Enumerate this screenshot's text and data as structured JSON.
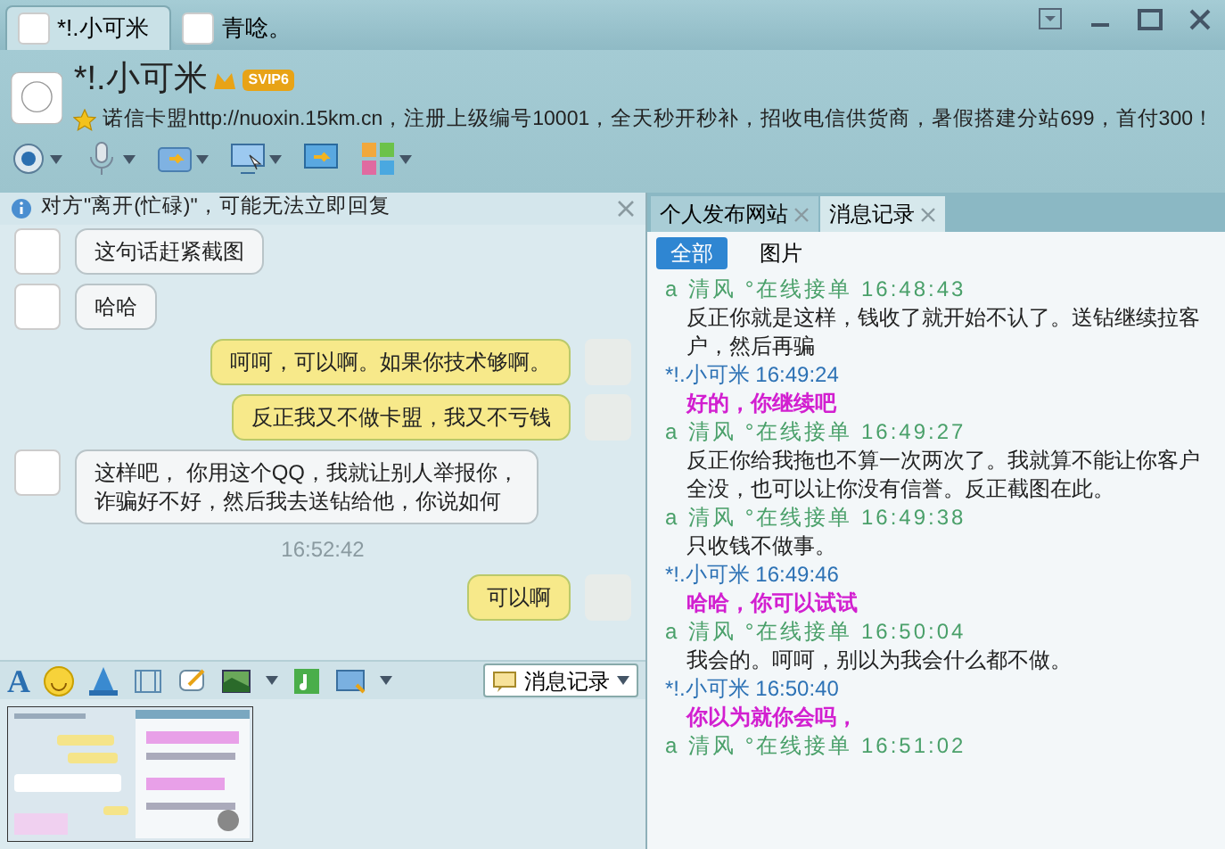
{
  "conversation_tabs": [
    {
      "label": "*!.小可米",
      "selected": true
    },
    {
      "label": "青唸。",
      "selected": false
    }
  ],
  "contact": {
    "name": "*!.小可米",
    "vip_badge": "SVIP6",
    "signature": "诺信卡盟http://nuoxin.15km.cn，注册上级编号10001，全天秒开秒补，招收电信供货商，暑假搭建分站699，首付300！"
  },
  "notice": "对方\"离开(忙碌)\"，可能无法立即回复",
  "chat": [
    {
      "kind": "left",
      "text": "这句话赶紧截图"
    },
    {
      "kind": "left",
      "text": "哈哈"
    },
    {
      "kind": "right",
      "text": "呵呵，可以啊。如果你技术够啊。"
    },
    {
      "kind": "right",
      "text": "反正我又不做卡盟，我又不亏钱"
    },
    {
      "kind": "left",
      "text": "这样吧， 你用这个QQ，我就让别人举报你，诈骗好不好，然后我去送钻给他，你说如何"
    },
    {
      "kind": "time",
      "text": "16:52:42"
    },
    {
      "kind": "right",
      "text": "可以啊"
    }
  ],
  "font_button": "A",
  "history_button": "消息记录",
  "panel_tabs": [
    {
      "label": "个人发布网站",
      "selected": false
    },
    {
      "label": "消息记录",
      "selected": true
    }
  ],
  "filters": [
    {
      "label": "全部",
      "selected": true
    },
    {
      "label": "图片",
      "selected": false
    }
  ],
  "history": [
    {
      "kind": "other",
      "sender": "a 清风 °在线接单",
      "time": "16:48:43",
      "text": "反正你就是这样，钱收了就开始不认了。送钻继续拉客户，然后再骗"
    },
    {
      "kind": "self",
      "sender": "*!.小可米",
      "time": "16:49:24",
      "text": "好的，你继续吧"
    },
    {
      "kind": "other",
      "sender": "a 清风 °在线接单",
      "time": "16:49:27",
      "text": "反正你给我拖也不算一次两次了。我就算不能让你客户全没，也可以让你没有信誉。反正截图在此。"
    },
    {
      "kind": "other",
      "sender": "a 清风 °在线接单",
      "time": "16:49:38",
      "text": "只收钱不做事。"
    },
    {
      "kind": "self",
      "sender": "*!.小可米",
      "time": "16:49:46",
      "text": "哈哈，你可以试试"
    },
    {
      "kind": "other",
      "sender": "a 清风 °在线接单",
      "time": "16:50:04",
      "text": "我会的。呵呵，别以为我会什么都不做。"
    },
    {
      "kind": "self",
      "sender": "*!.小可米",
      "time": "16:50:40",
      "text": "你以为就你会吗，"
    },
    {
      "kind": "other",
      "sender": "a 清风 °在线接单",
      "time": "16:51:02"
    }
  ]
}
